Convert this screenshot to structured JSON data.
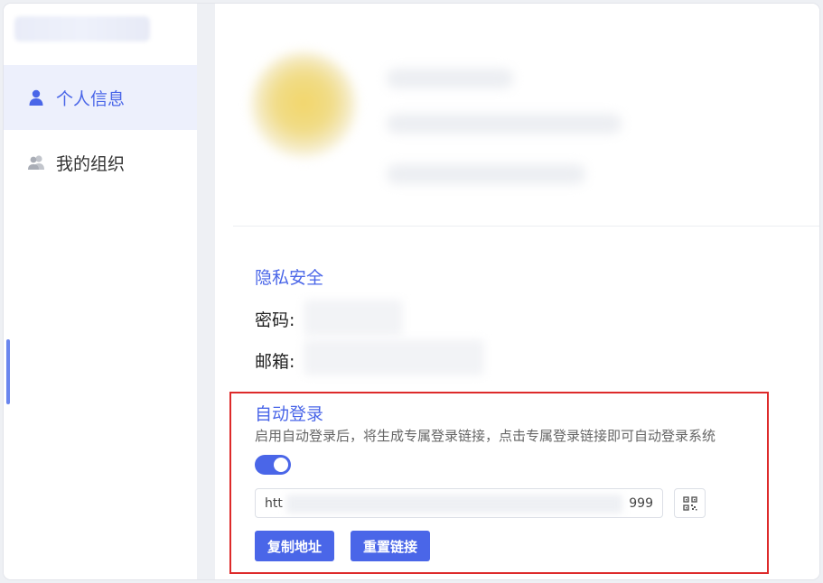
{
  "sidebar": {
    "items": [
      {
        "label": "个人信息",
        "icon": "user-icon",
        "active": true
      },
      {
        "label": "我的组织",
        "icon": "users-icon",
        "active": false
      }
    ]
  },
  "privacy": {
    "title": "隐私安全",
    "password_label": "密码:",
    "email_label": "邮箱:"
  },
  "auto_login": {
    "title": "自动登录",
    "description": "启用自动登录后，将生成专属登录链接，点击专属登录链接即可自动登录系统",
    "enabled": true,
    "link_start": "htt",
    "link_end": "999",
    "copy_button": "复制地址",
    "reset_button": "重置链接",
    "qr_icon": "qr-code-icon"
  },
  "colors": {
    "accent": "#4a66e8",
    "highlight": "#dd2a2a"
  }
}
